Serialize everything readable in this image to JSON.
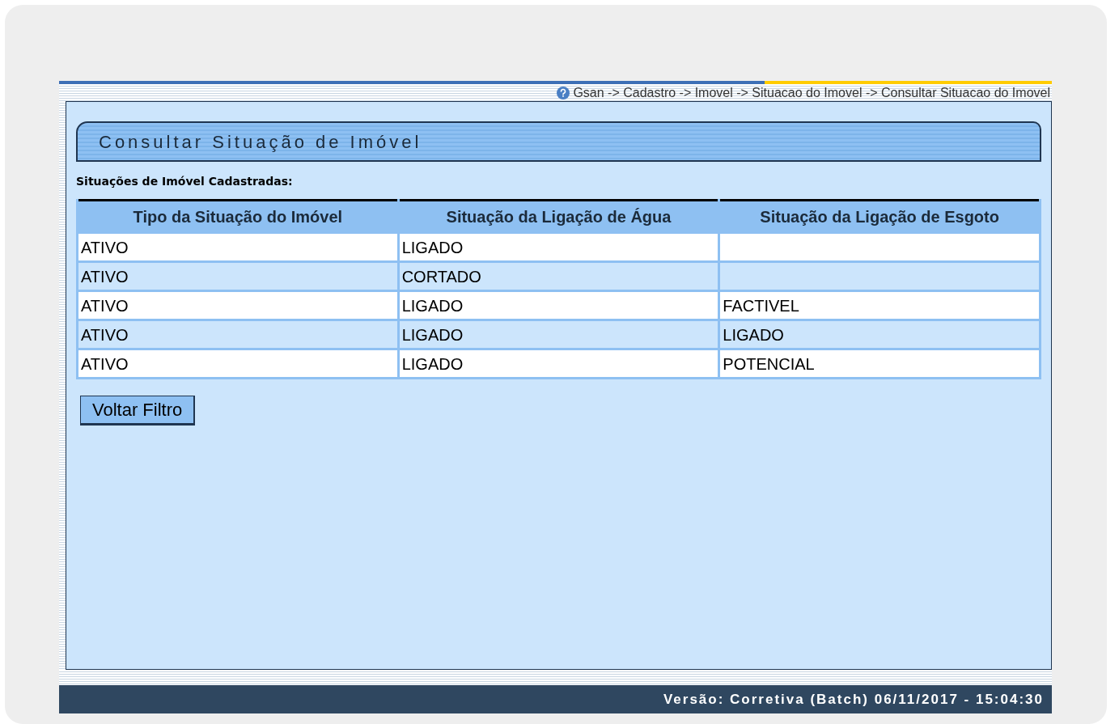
{
  "breadcrumb": "Gsan -> Cadastro -> Imovel -> Situacao do Imovel -> Consultar Situacao do Imovel",
  "title": "Consultar Situação de Imóvel",
  "section_label": "Situações de Imóvel Cadastradas:",
  "table": {
    "columns": [
      "Tipo da Situação do Imóvel",
      "Situação da Ligação de Água",
      "Situação da Ligação de Esgoto"
    ],
    "rows": [
      {
        "cells": [
          "ATIVO",
          "LIGADO"
        ]
      },
      {
        "cells": [
          "ATIVO",
          "CORTADO"
        ]
      },
      {
        "cells": [
          "ATIVO",
          "LIGADO",
          "FACTIVEL"
        ]
      },
      {
        "cells": [
          "ATIVO",
          "LIGADO",
          "LIGADO"
        ]
      },
      {
        "cells": [
          "ATIVO",
          "LIGADO",
          "POTENCIAL"
        ]
      }
    ]
  },
  "buttons": [
    "Voltar Filtro"
  ],
  "status_bar": "Versão: Corretiva (Batch) 06/11/2017 - 15:04:30"
}
